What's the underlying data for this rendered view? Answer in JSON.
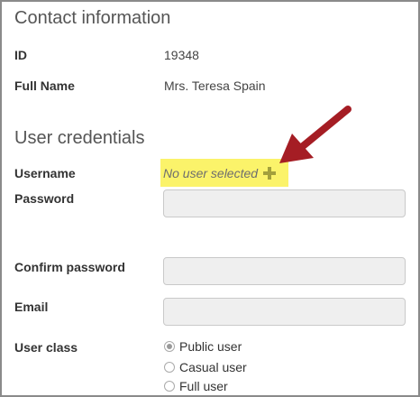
{
  "contact": {
    "title": "Contact information",
    "id_label": "ID",
    "id_value": "19348",
    "fullname_label": "Full Name",
    "fullname_value": "Mrs. Teresa Spain"
  },
  "credentials": {
    "title": "User credentials",
    "username_label": "Username",
    "username_value": "No user selected",
    "password_label": "Password",
    "confirm_label": "Confirm password",
    "email_label": "Email",
    "userclass_label": "User class",
    "userclass_options": [
      "Public user",
      "Casual user",
      "Full user"
    ],
    "userclass_selected": "Public user"
  },
  "icons": {
    "add": "plus-icon",
    "annotation": "arrow-icon"
  },
  "colors": {
    "highlight": "#fbf36a",
    "arrow": "#a51d24",
    "plus": "#a3a03c"
  }
}
